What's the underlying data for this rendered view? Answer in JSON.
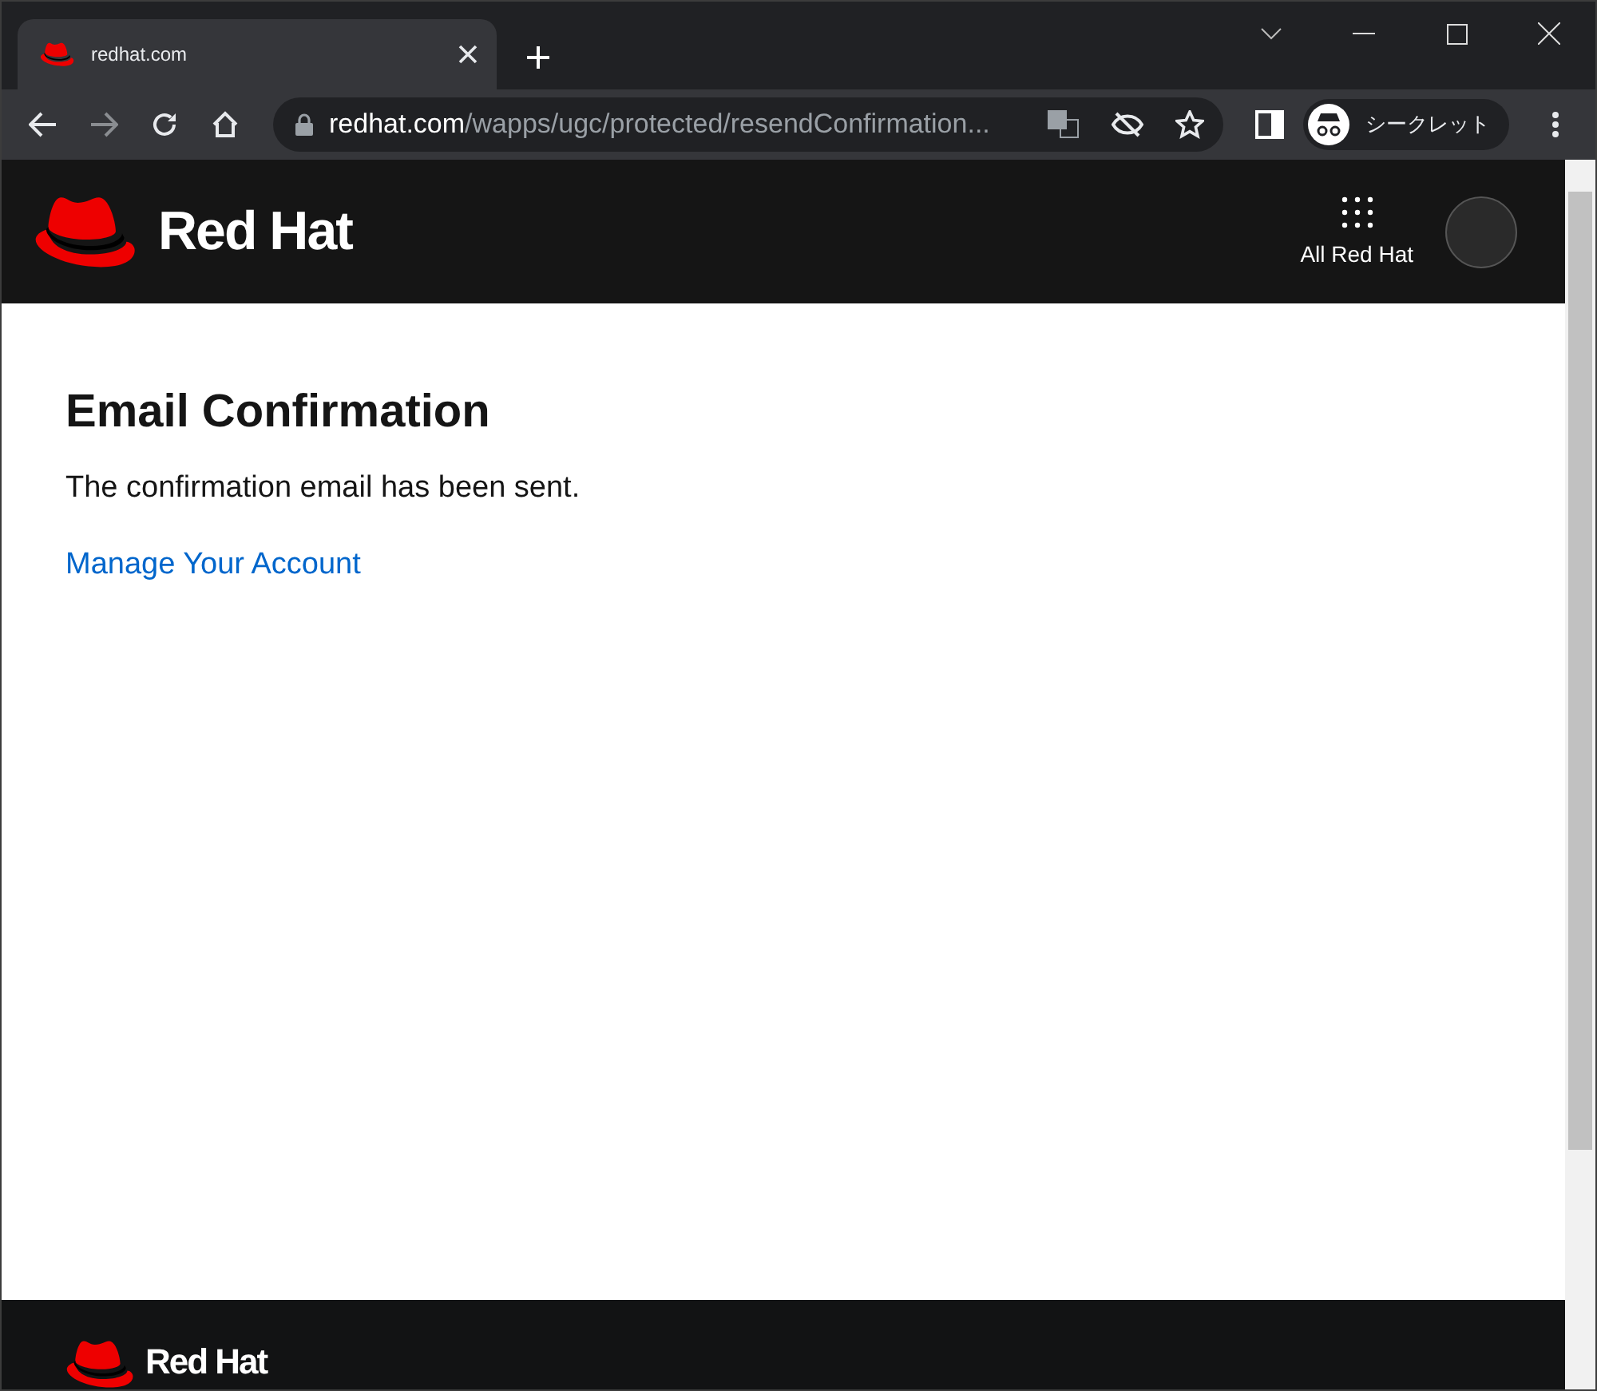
{
  "browser": {
    "tab": {
      "title": "redhat.com",
      "selected": true
    },
    "address": {
      "host": "redhat.com",
      "path": "/wapps/ugc/protected/resendConfirmation..."
    },
    "profile": {
      "label": "シークレット"
    }
  },
  "header": {
    "logo_text": "Red Hat",
    "menu_label": "All Red Hat"
  },
  "content": {
    "title": "Email Confirmation",
    "message": "The confirmation email has been sent.",
    "link": "Manage Your Account"
  },
  "footer": {
    "logo_text": "Red Hat"
  }
}
